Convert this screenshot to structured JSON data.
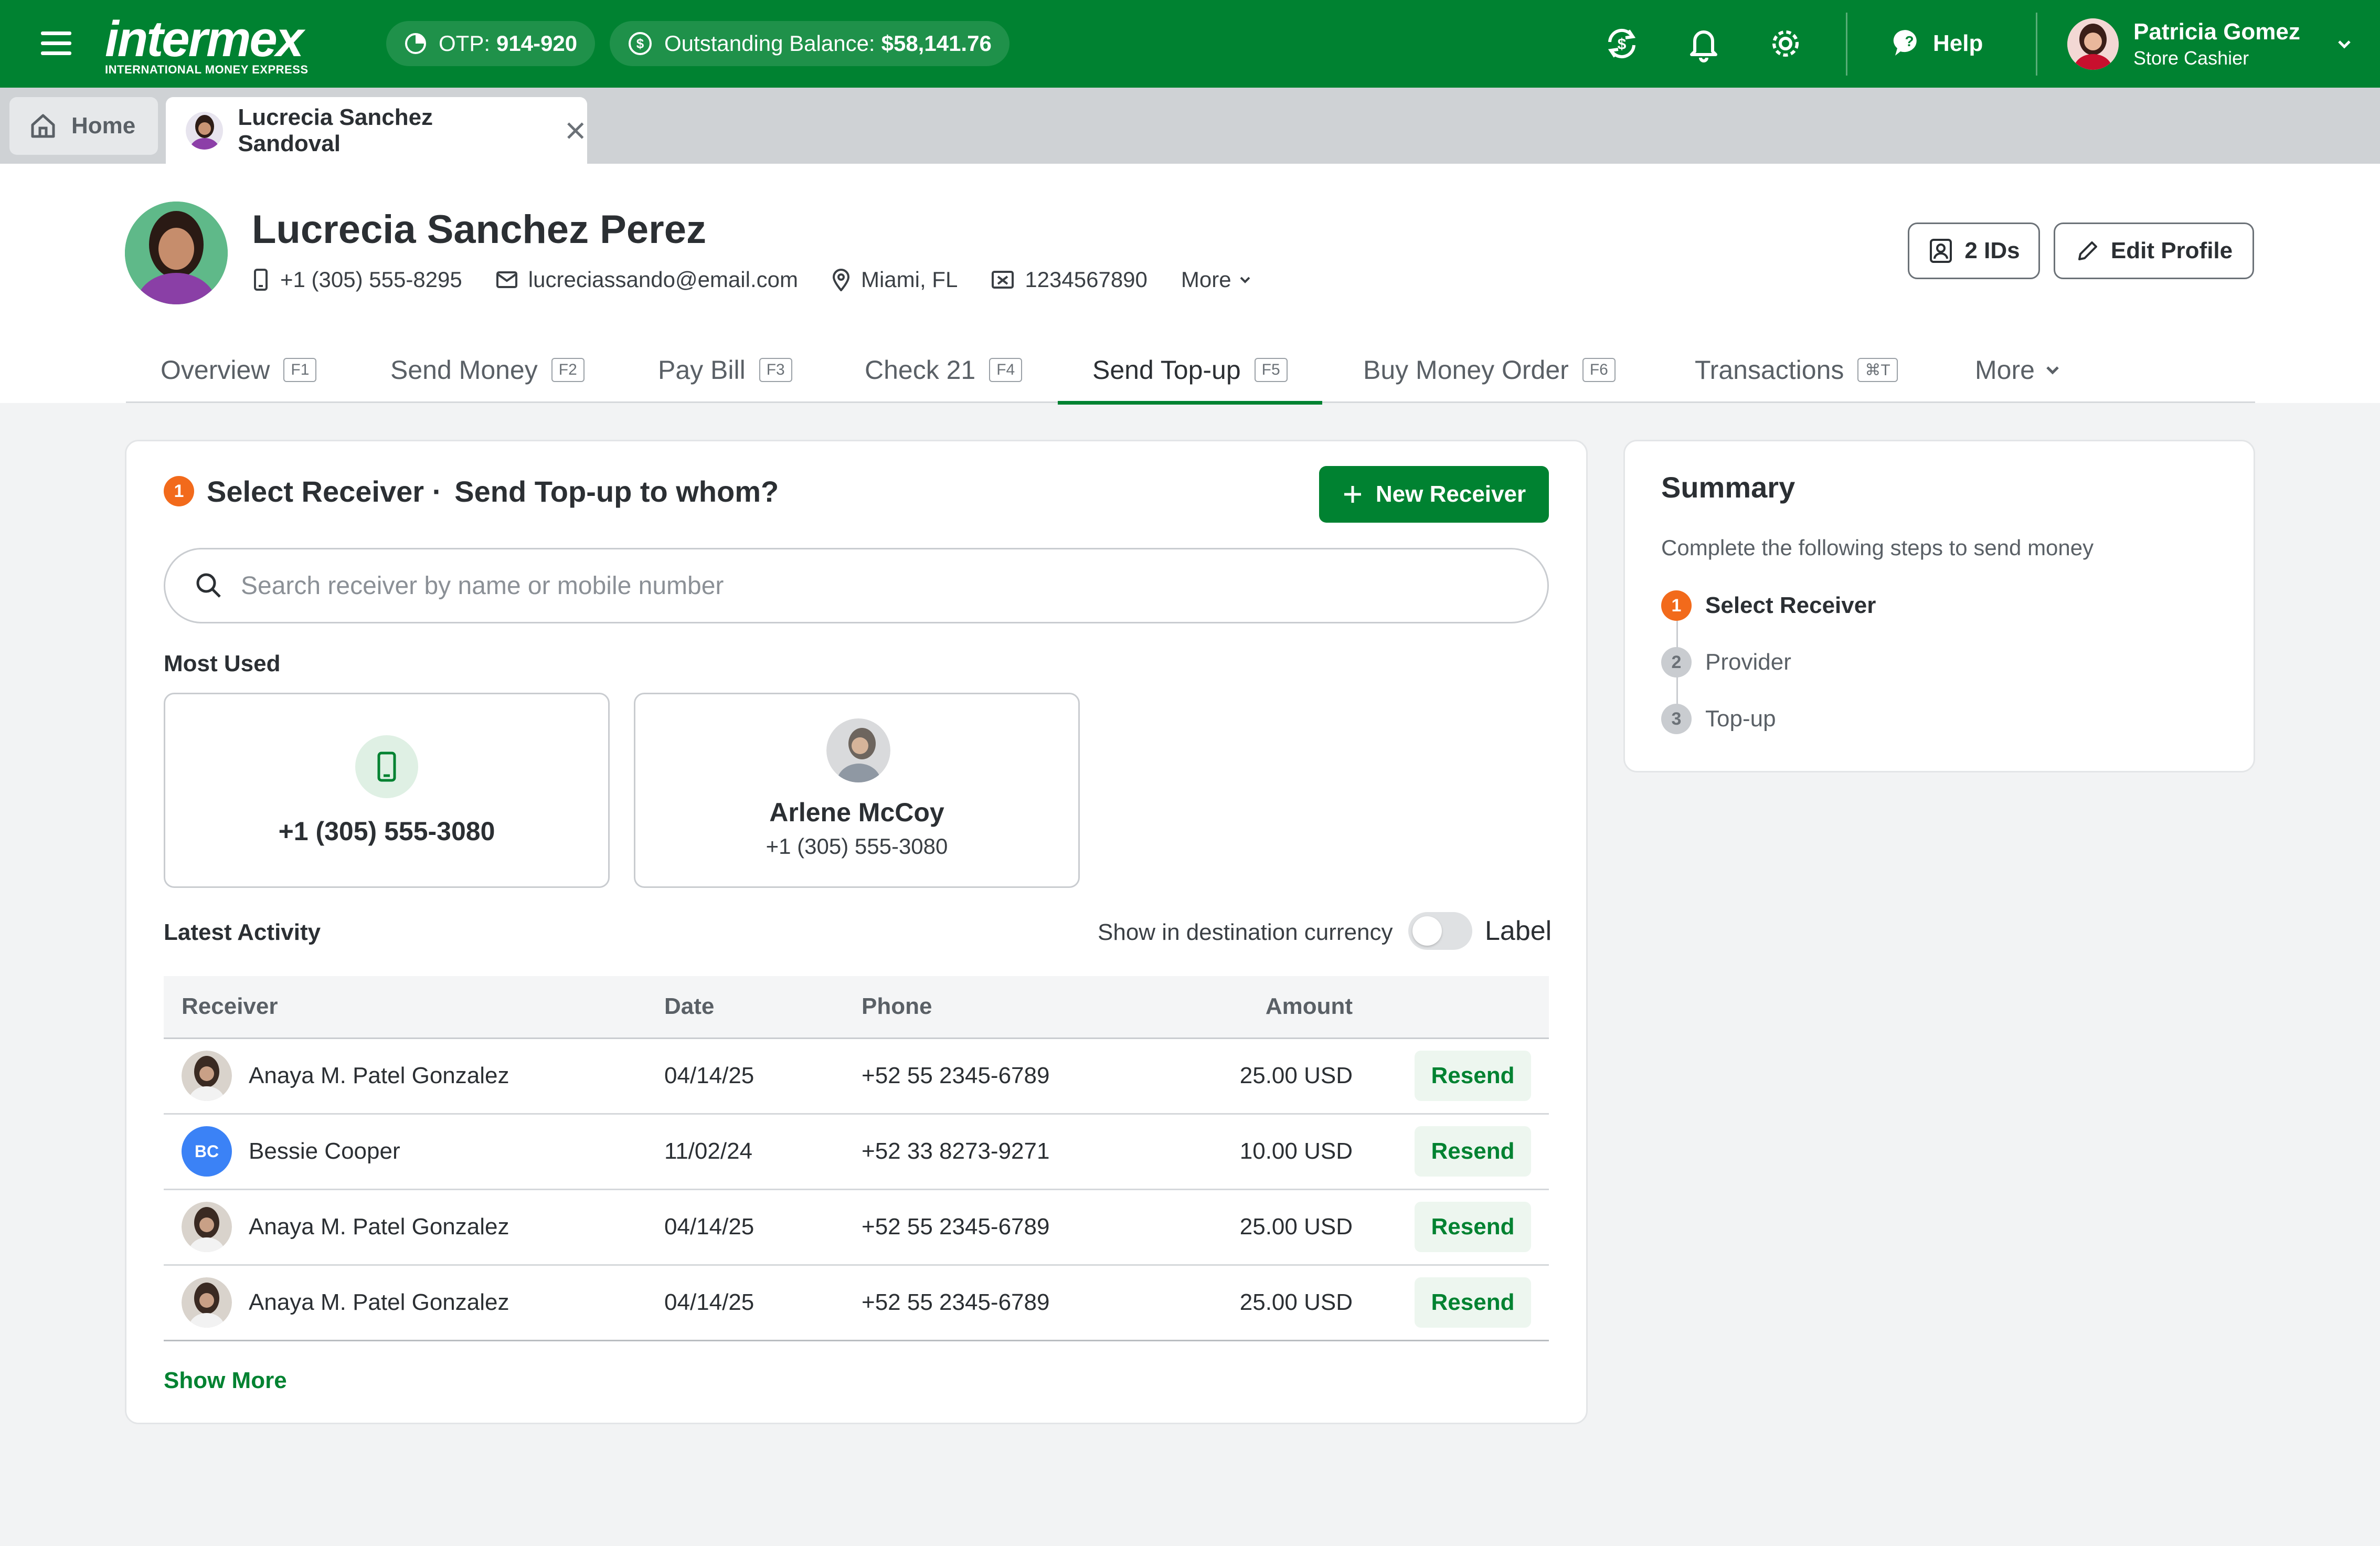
{
  "topbar": {
    "logo_word": "intermex",
    "logo_tag": "INTERNATIONAL MONEY EXPRESS",
    "otp_label": "OTP:",
    "otp_value": "914-920",
    "balance_label": "Outstanding Balance:",
    "balance_value": "$58,141.76",
    "help": "Help",
    "user_name": "Patricia Gomez",
    "user_role": "Store Cashier"
  },
  "tabs": {
    "home": "Home",
    "customer": "Lucrecia Sanchez Sandoval"
  },
  "profile": {
    "name": "Lucrecia Sanchez Perez",
    "phone": "+1 (305) 555-8295",
    "email": "lucreciassando@email.com",
    "location": "Miami, FL",
    "id_number": "1234567890",
    "more": "More",
    "ids_button": "2 IDs",
    "edit_button": "Edit Profile"
  },
  "nav": [
    {
      "label": "Overview",
      "key": "F1"
    },
    {
      "label": "Send Money",
      "key": "F2"
    },
    {
      "label": "Pay Bill",
      "key": "F3"
    },
    {
      "label": "Check 21",
      "key": "F4"
    },
    {
      "label": "Send Top-up",
      "key": "F5"
    },
    {
      "label": "Buy Money Order",
      "key": "F6"
    },
    {
      "label": "Transactions",
      "key": "⌘T"
    },
    {
      "label": "More",
      "key": ""
    }
  ],
  "active_nav": "Send Top-up",
  "receiver": {
    "step": "1",
    "title": "Select Receiver ·",
    "subtitle": "Send Top-up to whom?",
    "new_button": "New Receiver",
    "search_placeholder": "Search receiver by name or mobile number",
    "most_used_label": "Most Used",
    "most_used": [
      {
        "title": "+1 (305) 555-3080",
        "sub": ""
      },
      {
        "title": "Arlene McCoy",
        "sub": "+1 (305) 555-3080"
      }
    ],
    "latest_label": "Latest Activity",
    "toggle_text": "Show in destination currency",
    "toggle_label": "Label",
    "columns": [
      "Receiver",
      "Date",
      "Phone",
      "Amount"
    ],
    "rows": [
      {
        "receiver": "Anaya M. Patel Gonzalez",
        "initials": "",
        "date": "04/14/25",
        "phone": "+52 55 2345-6789",
        "amount": "25.00 USD",
        "action": "Resend"
      },
      {
        "receiver": "Bessie Cooper",
        "initials": "BC",
        "date": "11/02/24",
        "phone": "+52 33 8273-9271",
        "amount": "10.00 USD",
        "action": "Resend"
      },
      {
        "receiver": "Anaya M. Patel Gonzalez",
        "initials": "",
        "date": "04/14/25",
        "phone": "+52 55 2345-6789",
        "amount": "25.00 USD",
        "action": "Resend"
      },
      {
        "receiver": "Anaya M. Patel Gonzalez",
        "initials": "",
        "date": "04/14/25",
        "phone": "+52 55 2345-6789",
        "amount": "25.00 USD",
        "action": "Resend"
      }
    ],
    "show_more": "Show More"
  },
  "summary": {
    "title": "Summary",
    "description": "Complete the following steps to send money",
    "steps": [
      {
        "num": "1",
        "label": "Select Receiver"
      },
      {
        "num": "2",
        "label": "Provider"
      },
      {
        "num": "3",
        "label": "Top-up"
      }
    ]
  },
  "colors": {
    "brand_green": "#008231",
    "step_active": "#f26a1b",
    "initials_avatar": "#3b82f6"
  }
}
